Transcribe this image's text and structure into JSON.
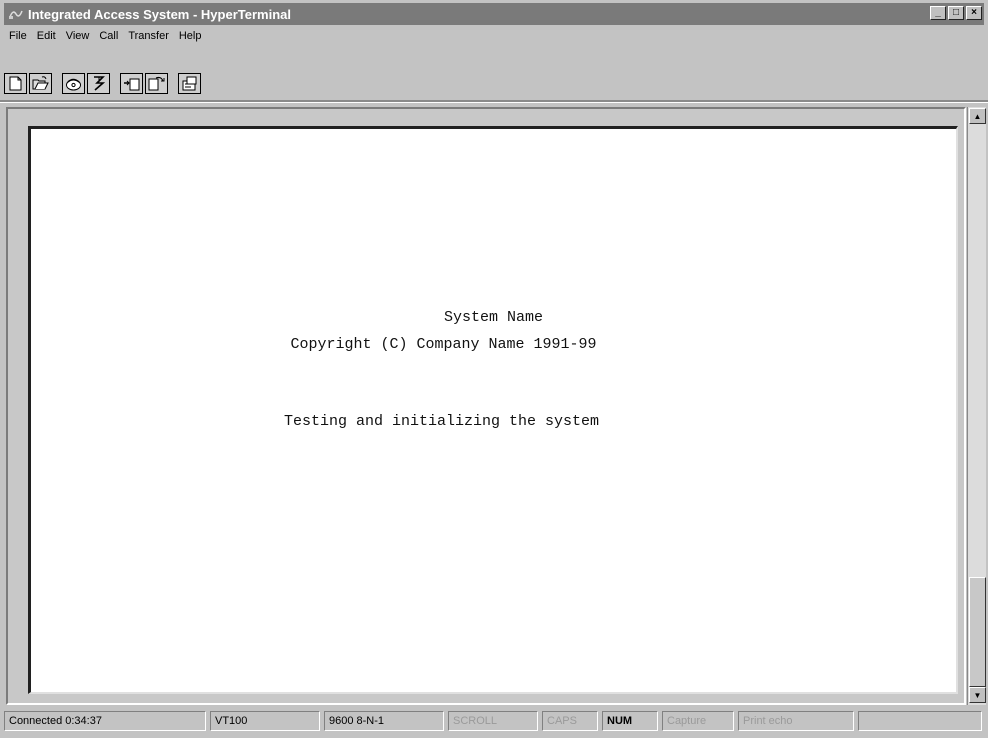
{
  "window": {
    "title": "Integrated Access System - HyperTerminal",
    "controls": {
      "minimize": "_",
      "maximize": "□",
      "close": "×"
    }
  },
  "menu": {
    "items": [
      {
        "label": "File"
      },
      {
        "label": "Edit"
      },
      {
        "label": "View"
      },
      {
        "label": "Call"
      },
      {
        "label": "Transfer"
      },
      {
        "label": "Help"
      }
    ]
  },
  "toolbar": {
    "buttons": [
      {
        "icon": "new-document-icon"
      },
      {
        "icon": "open-folder-icon"
      },
      {
        "icon": "call-phone-icon"
      },
      {
        "icon": "disconnect-icon"
      },
      {
        "icon": "send-file-icon"
      },
      {
        "icon": "receive-file-icon"
      },
      {
        "icon": "properties-icon"
      }
    ]
  },
  "terminal": {
    "line1": "System Name",
    "line2": "Copyright (C) Company Name 1991-99",
    "line3": "Testing and initializing the system"
  },
  "status": {
    "connected": "Connected 0:34:37",
    "emulation": "VT100",
    "settings": "9600 8-N-1",
    "scroll": "SCROLL",
    "caps": "CAPS",
    "num": "NUM",
    "capture": "Capture",
    "print_echo": "Print echo"
  }
}
